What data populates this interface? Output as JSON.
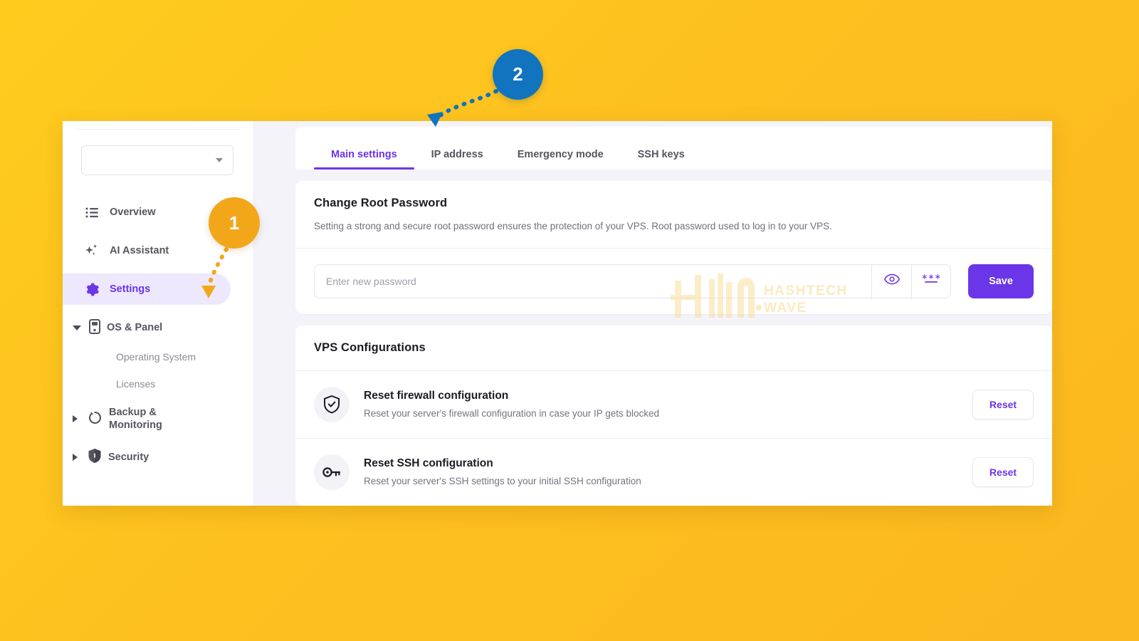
{
  "background": {
    "color_start": "#FFCC1E",
    "color_end": "#FBB81F"
  },
  "accent": {
    "primary": "#6B35E8",
    "marker_orange": "#F2A71B",
    "marker_blue": "#1273BE"
  },
  "annotations": [
    {
      "label": "1",
      "target": "sidebar-item-settings",
      "color": "#F2A71B"
    },
    {
      "label": "2",
      "target": "tab-main-settings",
      "color": "#1273BE"
    }
  ],
  "sidebar": {
    "server_select": {
      "value": "",
      "placeholder": ""
    },
    "items": [
      {
        "label": "Overview",
        "icon": "list-icon",
        "active": false,
        "type": "item"
      },
      {
        "label": "AI Assistant",
        "icon": "sparkle-icon",
        "active": false,
        "type": "item"
      },
      {
        "label": "Settings",
        "icon": "gear-icon",
        "active": true,
        "type": "item"
      },
      {
        "label": "OS & Panel",
        "icon": "server-icon",
        "expanded": true,
        "type": "group"
      },
      {
        "label": "Operating System",
        "type": "sub"
      },
      {
        "label": "Licenses",
        "type": "sub"
      },
      {
        "label": "Backup & Monitoring",
        "icon": "refresh-icon",
        "expanded": false,
        "type": "group"
      },
      {
        "label": "Security",
        "icon": "shield-icon",
        "expanded": false,
        "type": "group"
      }
    ]
  },
  "main": {
    "tabs": [
      {
        "label": "Main settings",
        "active": true
      },
      {
        "label": "IP address",
        "active": false
      },
      {
        "label": "Emergency mode",
        "active": false
      },
      {
        "label": "SSH keys",
        "active": false
      }
    ],
    "password_card": {
      "title": "Change Root Password",
      "description": "Setting a strong and secure root password ensures the protection of your VPS. Root password used to log in to your VPS.",
      "input": {
        "value": "",
        "placeholder": "Enter new password"
      },
      "toggle_visibility_icon": "eye-icon",
      "generate_password_icon": "generate-password-icon",
      "save_label": "Save"
    },
    "vps_card": {
      "title": "VPS Configurations",
      "rows": [
        {
          "icon": "shield-check-icon",
          "title": "Reset firewall configuration",
          "description": "Reset your server's firewall configuration in case your IP gets blocked",
          "action_label": "Reset"
        },
        {
          "icon": "key-icon",
          "title": "Reset SSH configuration",
          "description": "Reset your server's SSH settings to your initial SSH configuration",
          "action_label": "Reset"
        }
      ]
    }
  },
  "watermark": {
    "line1": "HASHTECH",
    "line2": "WAVE"
  }
}
